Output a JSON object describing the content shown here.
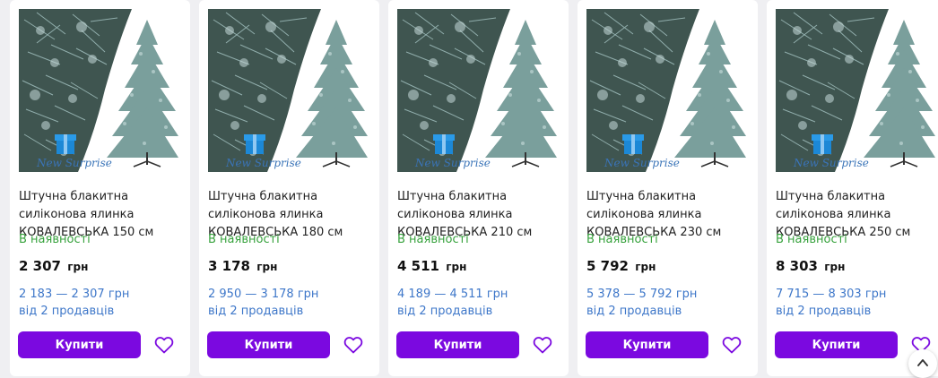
{
  "products": [
    {
      "title": "Штучна блакитна силіконова ялинка КОВАЛЕВСЬКА 150 см",
      "availability": "В наявності",
      "price": "2 307",
      "currency": "грн",
      "price_range": "2 183 — 2 307 грн",
      "sellers": "від 2 продавців",
      "buy_label": "Купити"
    },
    {
      "title": "Штучна блакитна силіконова ялинка КОВАЛЕВСЬКА 180 см",
      "availability": "В наявності",
      "price": "3 178",
      "currency": "грн",
      "price_range": "2 950 — 3 178 грн",
      "sellers": "від 2 продавців",
      "buy_label": "Купити"
    },
    {
      "title": "Штучна блакитна силіконова ялинка КОВАЛЕВСЬКА 210 см",
      "availability": "В наявності",
      "price": "4 511",
      "currency": "грн",
      "price_range": "4 189 — 4 511 грн",
      "sellers": "від 2 продавців",
      "buy_label": "Купити"
    },
    {
      "title": "Штучна блакитна силіконова ялинка КОВАЛЕВСЬКА 230 см",
      "availability": "В наявності",
      "price": "5 792",
      "currency": "грн",
      "price_range": "5 378 — 5 792 грн",
      "sellers": "від 2 продавців",
      "buy_label": "Купити"
    },
    {
      "title": "Штучна блакитна силіконова ялинка КОВАЛЕВСЬКА 250 см",
      "availability": "В наявності",
      "price": "8 303",
      "currency": "грн",
      "price_range": "7 715 — 8 303 грн",
      "sellers": "від 2 продавців",
      "buy_label": "Купити"
    }
  ],
  "image": {
    "watermark": "New Surprise",
    "icon": "gift-box-icon"
  },
  "icons": {
    "favorite": "heart-outline-icon",
    "scroll_top": "chevron-up-icon"
  },
  "colors": {
    "accent": "#7b09e0",
    "in_stock": "#37a23d",
    "link": "#3e77c9",
    "price_text": "#111111"
  }
}
